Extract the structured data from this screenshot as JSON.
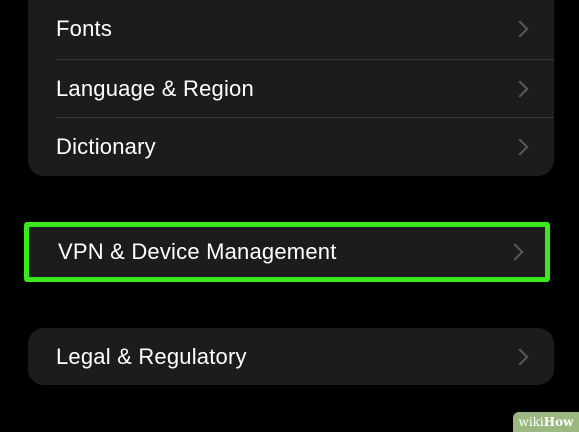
{
  "settings": {
    "general_group": [
      {
        "label": "Fonts"
      },
      {
        "label": "Language & Region"
      },
      {
        "label": "Dictionary"
      }
    ],
    "vpn_item": {
      "label": "VPN & Device Management"
    },
    "legal_item": {
      "label": "Legal & Regulatory"
    }
  },
  "watermark": {
    "wiki": "wiki",
    "how": "How"
  },
  "colors": {
    "background": "#000000",
    "cell": "#1c1c1e",
    "highlight": "#39ea1b",
    "chevron": "#5a5a5e"
  }
}
